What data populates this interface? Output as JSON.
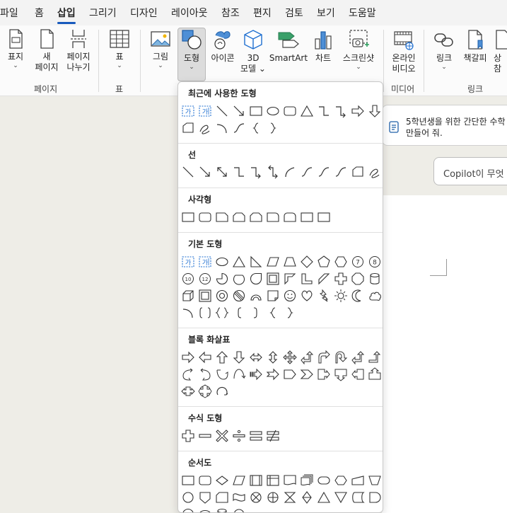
{
  "tabs": [
    {
      "id": "file",
      "label": "파일",
      "active": false
    },
    {
      "id": "home",
      "label": "홈",
      "active": false
    },
    {
      "id": "insert",
      "label": "삽입",
      "active": true
    },
    {
      "id": "draw",
      "label": "그리기",
      "active": false
    },
    {
      "id": "design",
      "label": "디자인",
      "active": false
    },
    {
      "id": "layout",
      "label": "레이아웃",
      "active": false
    },
    {
      "id": "references",
      "label": "참조",
      "active": false
    },
    {
      "id": "editor",
      "label": "편지",
      "active": false
    },
    {
      "id": "review",
      "label": "검토",
      "active": false
    },
    {
      "id": "view",
      "label": "보기",
      "active": false
    },
    {
      "id": "help",
      "label": "도움말",
      "active": false
    }
  ],
  "ribbon": {
    "buttons": [
      {
        "id": "cover",
        "icon": "cover-page-icon",
        "lines": [
          "표지"
        ],
        "dropdown": true
      },
      {
        "id": "newpage",
        "icon": "new-page-icon",
        "lines": [
          "새",
          "페이지"
        ],
        "dropdown": false
      },
      {
        "id": "pagebreak",
        "icon": "page-break-icon",
        "lines": [
          "페이지",
          "나누기"
        ],
        "dropdown": false
      },
      {
        "id": "table",
        "icon": "table-icon",
        "lines": [
          "표"
        ],
        "dropdown": true
      },
      {
        "id": "picture",
        "icon": "picture-icon",
        "lines": [
          "그림"
        ],
        "dropdown": true
      },
      {
        "id": "shapes",
        "icon": "shapes-icon",
        "lines": [
          "도형"
        ],
        "dropdown": true,
        "selected": true
      },
      {
        "id": "icons",
        "icon": "icons-icon",
        "lines": [
          "아이콘"
        ],
        "dropdown": false
      },
      {
        "id": "3d",
        "icon": "3d-model-icon",
        "lines": [
          "3D",
          "모델"
        ],
        "dropdown": true
      },
      {
        "id": "smartart",
        "icon": "smartart-icon",
        "lines": [
          "SmartArt"
        ],
        "dropdown": false
      },
      {
        "id": "chart",
        "icon": "chart-icon",
        "lines": [
          "차트"
        ],
        "dropdown": false
      },
      {
        "id": "screenshot",
        "icon": "screenshot-icon",
        "lines": [
          "스크린샷"
        ],
        "dropdown": true
      },
      {
        "id": "onlinevideo",
        "icon": "online-video-icon",
        "lines": [
          "온라인",
          "비디오"
        ],
        "dropdown": false
      },
      {
        "id": "link",
        "icon": "link-icon",
        "lines": [
          "링크"
        ],
        "dropdown": true
      },
      {
        "id": "bookmark",
        "icon": "bookmark-icon",
        "lines": [
          "책갈피"
        ],
        "dropdown": false
      },
      {
        "id": "crossref",
        "icon": "cross-reference-icon",
        "lines": [
          "상",
          "참"
        ],
        "dropdown": false
      }
    ],
    "groups": [
      {
        "id": "pages",
        "label": "페이지"
      },
      {
        "id": "tables",
        "label": "표"
      },
      {
        "id": "media",
        "label": "미디어"
      },
      {
        "id": "links",
        "label": "링크"
      }
    ]
  },
  "dropdown": {
    "sections": [
      {
        "id": "recent",
        "title": "최근에 사용한 도형"
      },
      {
        "id": "lines",
        "title": "선"
      },
      {
        "id": "rects",
        "title": "사각형"
      },
      {
        "id": "basic",
        "title": "기본 도형"
      },
      {
        "id": "arrows",
        "title": "블록 화살표"
      },
      {
        "id": "equation",
        "title": "수식 도형"
      },
      {
        "id": "flowchart",
        "title": "순서도"
      }
    ]
  },
  "document": {
    "suggestion_line1": "5학년생을 위한 간단한 수학",
    "suggestion_line2": "만들어 줘.",
    "copilot_placeholder": "Copilot이 무엇"
  },
  "colors": {
    "accent": "#185abd",
    "shape_outline": "#333333",
    "selected_bg": "#dcdcdc"
  }
}
